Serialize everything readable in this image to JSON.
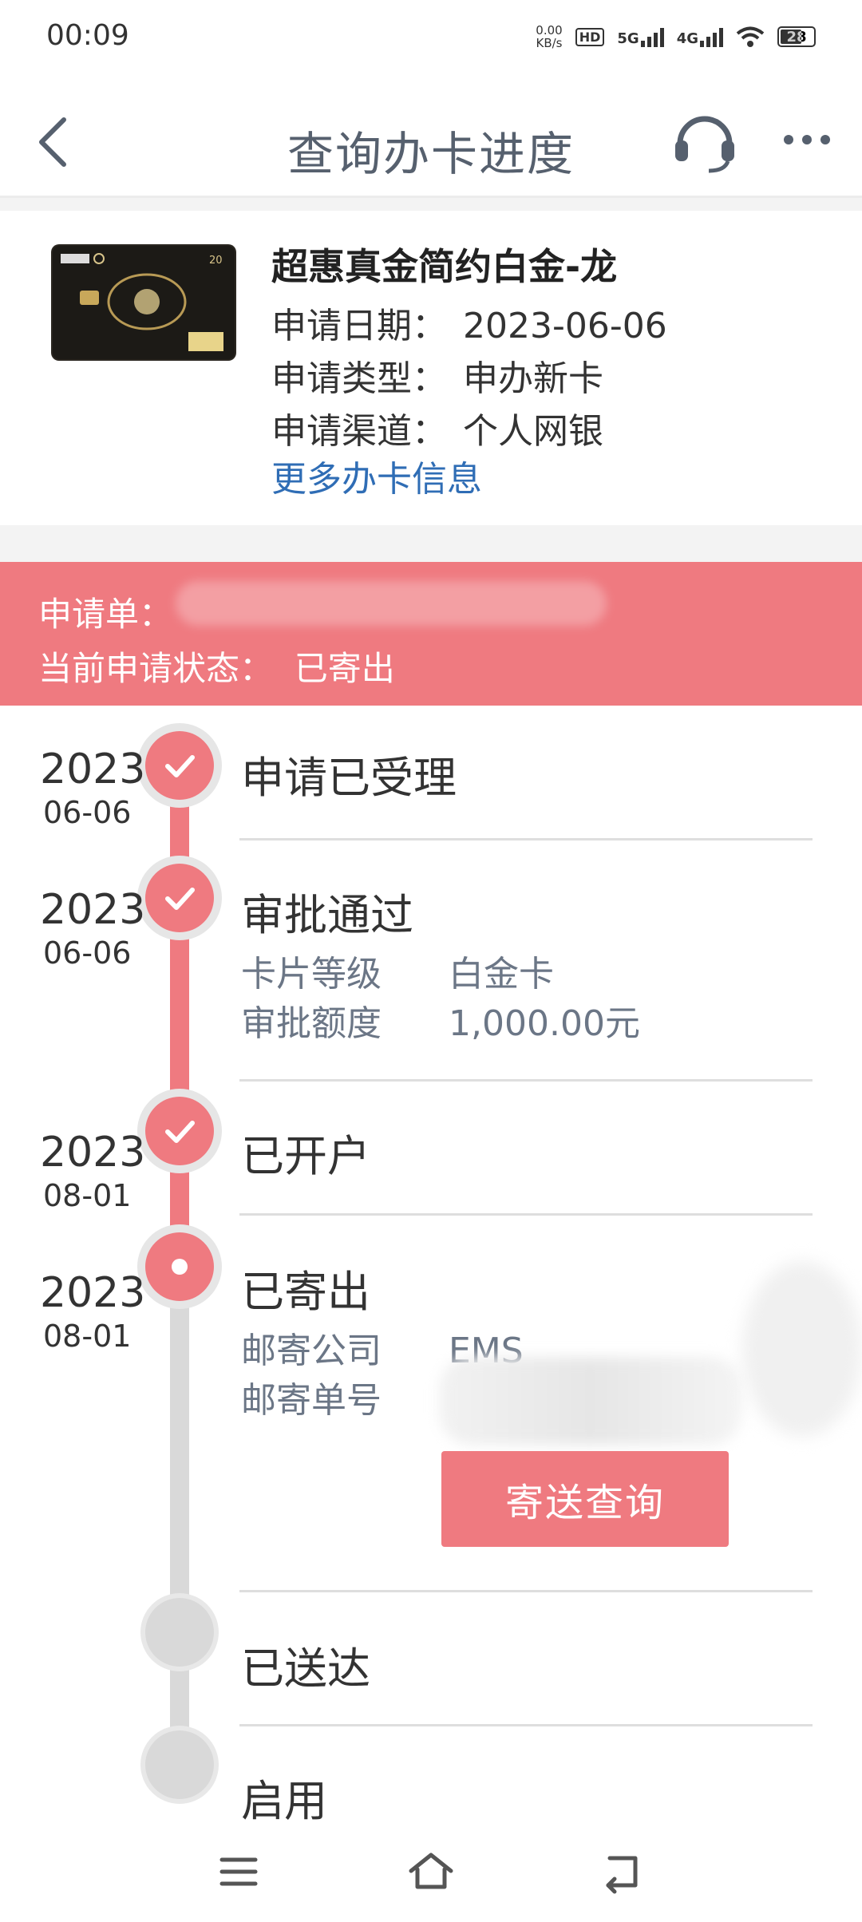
{
  "status_bar": {
    "time": "00:09",
    "net_speed_value": "0.00",
    "net_speed_unit": "KB/s",
    "hd_label": "HD",
    "sim1_label": "5G",
    "sim2_label": "4G",
    "battery": "28"
  },
  "header": {
    "title": "查询办卡进度",
    "back_icon": "back-chevron-icon",
    "service_icon": "headset-icon",
    "more_icon": "more-dots-icon"
  },
  "card": {
    "name": "超惠真金简约白金-龙",
    "rows": [
      {
        "label": "申请日期：",
        "value": "2023-06-06"
      },
      {
        "label": "申请类型：",
        "value": "申办新卡"
      },
      {
        "label": "申请渠道：",
        "value": "个人网银"
      }
    ],
    "more_link": "更多办卡信息"
  },
  "banner": {
    "application_label": "申请单：",
    "status_label": "当前申请状态：",
    "status_value": "已寄出"
  },
  "timeline": [
    {
      "year": "2023",
      "date": "06-06",
      "title": "申请已受理",
      "state": "done"
    },
    {
      "year": "2023",
      "date": "06-06",
      "title": "审批通过",
      "state": "done",
      "details": [
        {
          "key": "卡片等级",
          "value": "白金卡"
        },
        {
          "key": "审批额度",
          "value": "1,000.00元"
        }
      ]
    },
    {
      "year": "2023",
      "date": "08-01",
      "title": "已开户",
      "state": "done"
    },
    {
      "year": "2023",
      "date": "08-01",
      "title": "已寄出",
      "state": "current",
      "details": [
        {
          "key": "邮寄公司",
          "value": "EMS"
        },
        {
          "key": "邮寄单号",
          "value": ""
        }
      ],
      "button": "寄送查询"
    },
    {
      "title": "已送达",
      "state": "pending"
    },
    {
      "title": "启用",
      "state": "pending"
    }
  ],
  "colors": {
    "accent": "#ef7a80",
    "link": "#2f6db5",
    "title": "#56606e",
    "muted": "#6b7686"
  },
  "navbar": {
    "icons": [
      "menu-icon",
      "home-icon",
      "back-icon"
    ]
  }
}
